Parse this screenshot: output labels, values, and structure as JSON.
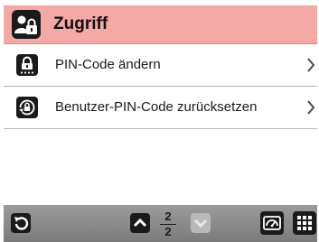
{
  "header": {
    "title": "Zugriff",
    "icon": "user-lock-icon",
    "background": "#f4a9a6"
  },
  "menu": [
    {
      "label": "PIN-Code ändern",
      "icon": "pin-lock-icon"
    },
    {
      "label": "Benutzer-PIN-Code zurücksetzen",
      "icon": "reset-lock-icon"
    }
  ],
  "pagination": {
    "current": "2",
    "total": "2"
  },
  "bottom_bar": {
    "back_icon": "back-arrow-icon",
    "up_icon": "chevron-up-icon",
    "down_icon": "chevron-down-icon",
    "dashboard_icon": "dashboard-gauge-icon",
    "grid_icon": "grid-menu-icon"
  }
}
